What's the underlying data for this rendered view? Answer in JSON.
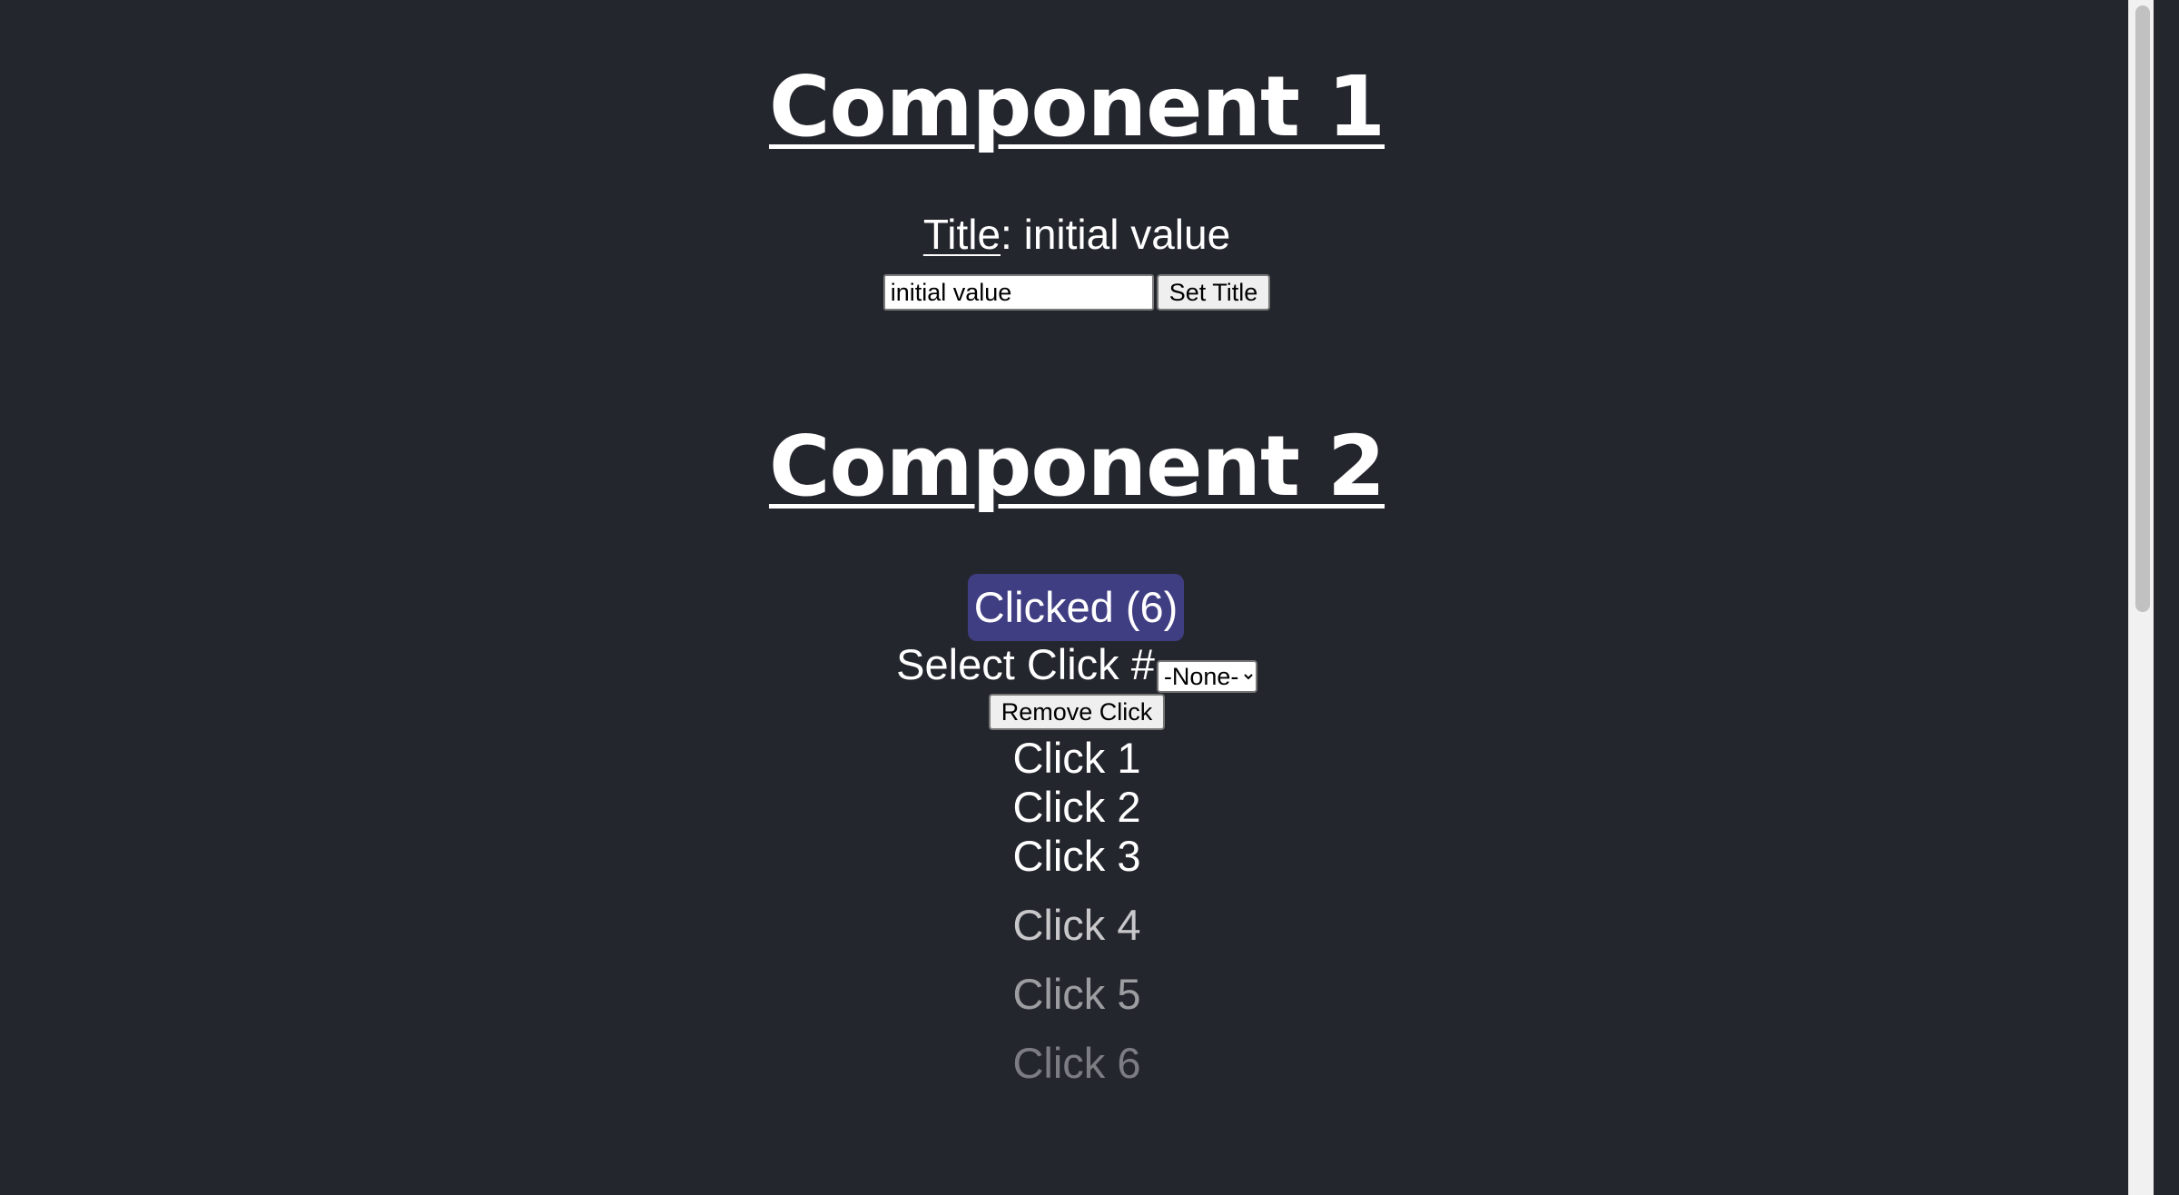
{
  "component1": {
    "heading": "Component 1",
    "title_label": "Title",
    "title_separator": ": ",
    "title_value": "initial value",
    "input_value": "initial value",
    "set_title_label": "Set Title"
  },
  "component2": {
    "heading": "Component 2",
    "clicked_button_label": "Clicked (6)",
    "select_label": "Select Click #",
    "select_selected": "-None-",
    "remove_label": "Remove Click",
    "clicks": [
      {
        "label": "Click 1",
        "opacity": 1.0
      },
      {
        "label": "Click 2",
        "opacity": 1.0
      },
      {
        "label": "Click 3",
        "opacity": 1.0
      },
      {
        "label": "Click 4",
        "opacity": 0.75
      },
      {
        "label": "Click 5",
        "opacity": 0.55
      },
      {
        "label": "Click 6",
        "opacity": 0.4
      }
    ]
  },
  "colors": {
    "background": "#24262e",
    "clicked_button": "#403e82",
    "text": "#ffffff"
  }
}
